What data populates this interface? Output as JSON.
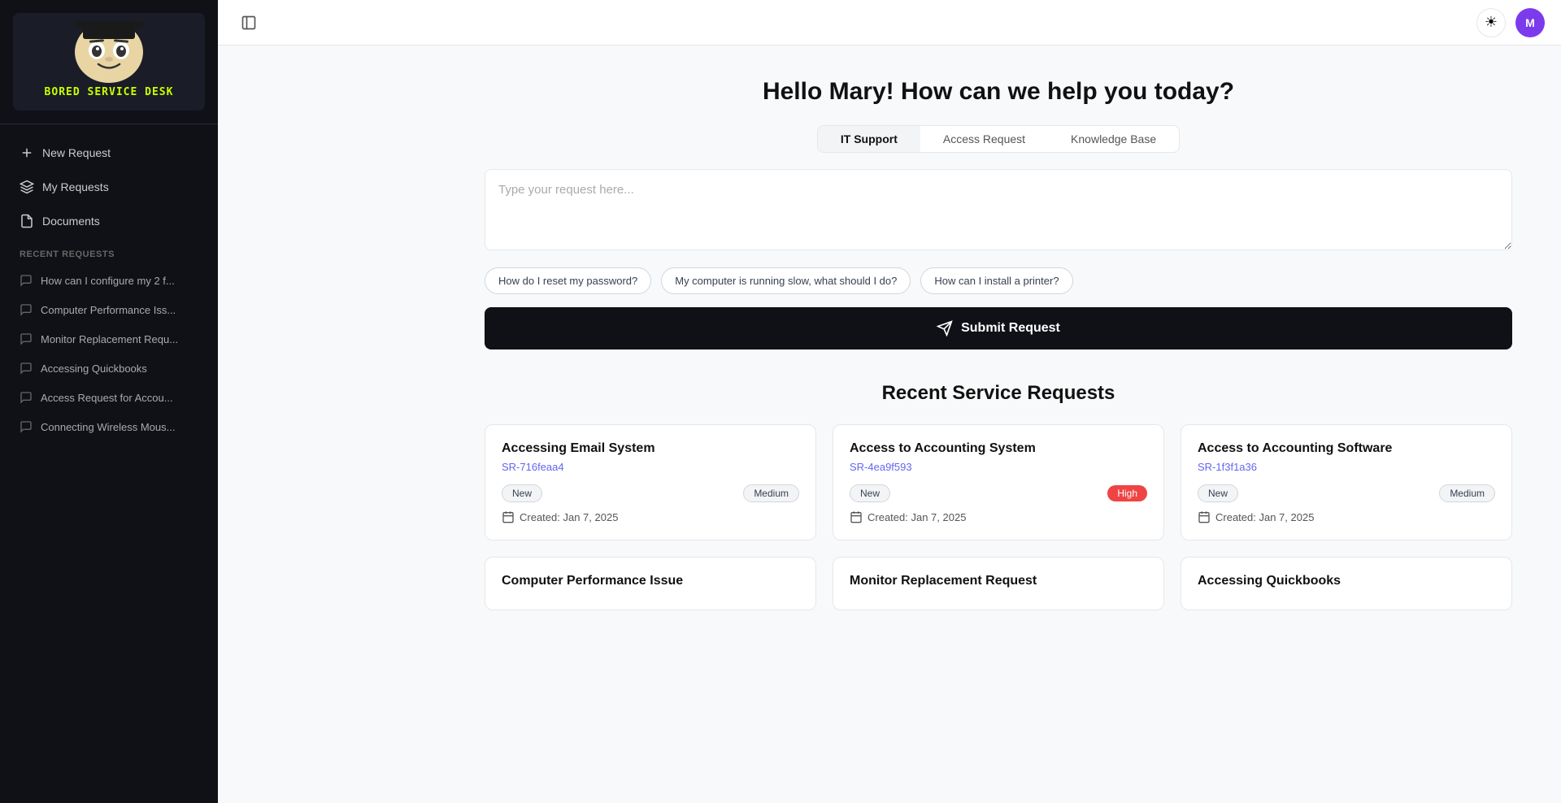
{
  "app": {
    "name": "Bored Service Desk",
    "greeting": "Hello Mary! How can we help you today?"
  },
  "sidebar": {
    "section_label": "Recent Requests",
    "nav": [
      {
        "id": "new-request",
        "label": "New Request",
        "icon": "plus"
      },
      {
        "id": "my-requests",
        "label": "My Requests",
        "icon": "layers"
      },
      {
        "id": "documents",
        "label": "Documents",
        "icon": "file"
      }
    ],
    "recent": [
      {
        "id": "recent-1",
        "label": "How can I configure my 2 f..."
      },
      {
        "id": "recent-2",
        "label": "Computer Performance Iss..."
      },
      {
        "id": "recent-3",
        "label": "Monitor Replacement Requ..."
      },
      {
        "id": "recent-4",
        "label": "Accessing Quickbooks"
      },
      {
        "id": "recent-5",
        "label": "Access Request for Accou..."
      },
      {
        "id": "recent-6",
        "label": "Connecting Wireless Mous..."
      }
    ]
  },
  "tabs": [
    {
      "id": "it-support",
      "label": "IT Support",
      "active": true
    },
    {
      "id": "access-request",
      "label": "Access Request",
      "active": false
    },
    {
      "id": "knowledge-base",
      "label": "Knowledge Base",
      "active": false
    }
  ],
  "request_box": {
    "placeholder": "Type your request here..."
  },
  "suggestions": [
    {
      "id": "s1",
      "label": "How do I reset my password?"
    },
    {
      "id": "s2",
      "label": "My computer is running slow, what should I do?"
    },
    {
      "id": "s3",
      "label": "How can I install a printer?"
    }
  ],
  "submit_button": {
    "label": "Submit Request"
  },
  "recent_section": {
    "title": "Recent Service Requests"
  },
  "cards": [
    {
      "id": "card-1",
      "title": "Accessing Email System",
      "ticket_id": "SR-716feaa4",
      "status": "New",
      "priority": "Medium",
      "priority_type": "medium",
      "date": "Created: Jan 7, 2025"
    },
    {
      "id": "card-2",
      "title": "Access to Accounting System",
      "ticket_id": "SR-4ea9f593",
      "status": "New",
      "priority": "High",
      "priority_type": "high",
      "date": "Created: Jan 7, 2025"
    },
    {
      "id": "card-3",
      "title": "Access to Accounting Software",
      "ticket_id": "SR-1f3f1a36",
      "status": "New",
      "priority": "Medium",
      "priority_type": "medium",
      "date": "Created: Jan 7, 2025"
    },
    {
      "id": "card-4",
      "title": "Computer Performance Issue",
      "ticket_id": "",
      "status": "",
      "priority": "",
      "priority_type": "",
      "date": ""
    },
    {
      "id": "card-5",
      "title": "Monitor Replacement Request",
      "ticket_id": "",
      "status": "",
      "priority": "",
      "priority_type": "",
      "date": ""
    },
    {
      "id": "card-6",
      "title": "Accessing Quickbooks",
      "ticket_id": "",
      "status": "",
      "priority": "",
      "priority_type": "",
      "date": ""
    }
  ]
}
